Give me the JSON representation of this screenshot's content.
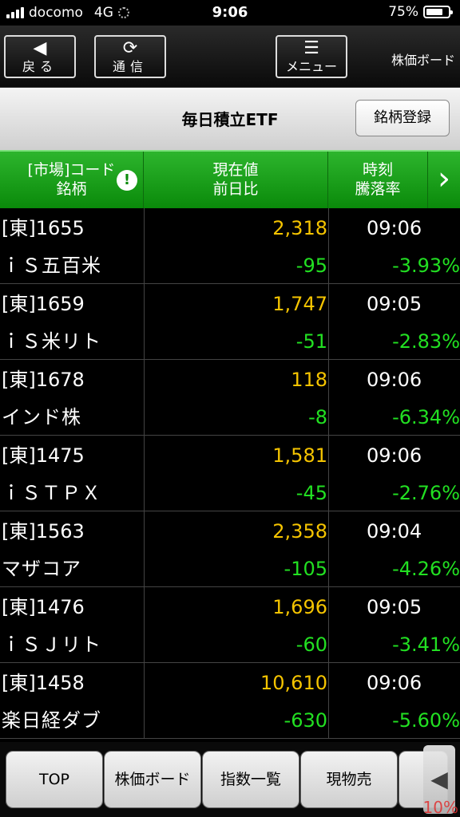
{
  "status_bar": {
    "carrier": "docomo",
    "network": "4G",
    "time": "9:06",
    "battery": "75%"
  },
  "toolbar": {
    "back_label": "戻る",
    "refresh_label": "通信",
    "menu_label": "メニュー",
    "board_label": "株価ボード"
  },
  "title_bar": {
    "title": "毎日積立ETF",
    "register_label": "銘柄登録"
  },
  "table": {
    "headers": {
      "col1_line1": "[市場]コード",
      "col1_line2": "銘柄",
      "col2_line1": "現在値",
      "col2_line2": "前日比",
      "col3_line1": "時刻",
      "col3_line2": "騰落率"
    },
    "rows": [
      {
        "code": "[東]1655",
        "name": "ｉＳ五百米",
        "price": "2,318",
        "change": "-95",
        "time": "09:06",
        "rate": "-3.93%"
      },
      {
        "code": "[東]1659",
        "name": "ｉＳ米リト",
        "price": "1,747",
        "change": "-51",
        "time": "09:05",
        "rate": "-2.83%"
      },
      {
        "code": "[東]1678",
        "name": "インド株",
        "price": "118",
        "change": "-8",
        "time": "09:06",
        "rate": "-6.34%"
      },
      {
        "code": "[東]1475",
        "name": "ｉＳＴＰＸ",
        "price": "1,581",
        "change": "-45",
        "time": "09:06",
        "rate": "-2.76%"
      },
      {
        "code": "[東]1563",
        "name": "マザコア",
        "price": "2,358",
        "change": "-105",
        "time": "09:04",
        "rate": "-4.26%"
      },
      {
        "code": "[東]1476",
        "name": "ｉＳＪリト",
        "price": "1,696",
        "change": "-60",
        "time": "09:05",
        "rate": "-3.41%"
      },
      {
        "code": "[東]1458",
        "name": "楽日経ダブ",
        "price": "10,610",
        "change": "-630",
        "time": "09:06",
        "rate": "-5.60%"
      }
    ]
  },
  "bottom_tabs": {
    "top": "TOP",
    "board": "株価ボード",
    "index_list": "指数一覧",
    "sell": "現物売",
    "overflow_percent": "10%"
  },
  "colors": {
    "price": "#f5c400",
    "change_negative": "#22e022",
    "header_green": "#0a8a0a"
  }
}
